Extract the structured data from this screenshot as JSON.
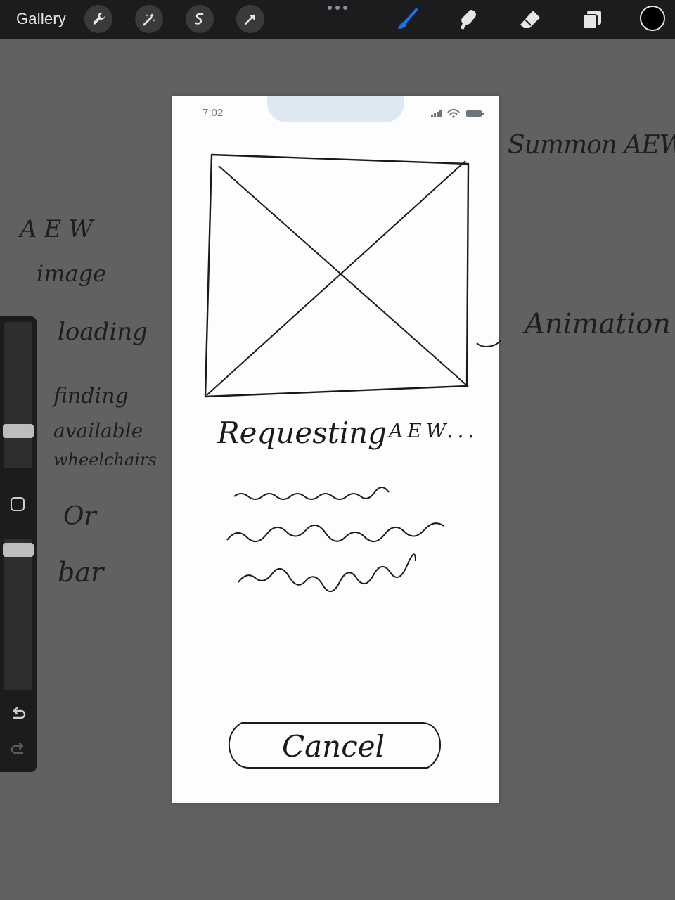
{
  "toolbar": {
    "gallery_label": "Gallery",
    "left_tools": [
      "wrench-icon",
      "magic-wand-icon",
      "selection-icon",
      "transform-arrow-icon"
    ],
    "right_tools": [
      "brush-icon",
      "smudge-icon",
      "eraser-icon",
      "layers-icon"
    ],
    "active_tool": "brush-icon",
    "accent_color": "#1a73e8",
    "current_color": "#000000"
  },
  "sidebar": {
    "brush_size_level": 0.27,
    "opacity_level": 0.94,
    "undo_icon": "undo-icon",
    "redo_icon": "redo-icon"
  },
  "canvas": {
    "status_time": "7:02",
    "heading_text": "Requesting",
    "heading_suffix": "AEW...",
    "cancel_label": "Cancel"
  },
  "annotations": {
    "right_top": "Summon AEW",
    "right_mid": "Animation",
    "left_lines": [
      "AEW",
      "image",
      "loading",
      "finding",
      "available",
      "wheelchairs",
      "Or",
      "bar"
    ]
  }
}
